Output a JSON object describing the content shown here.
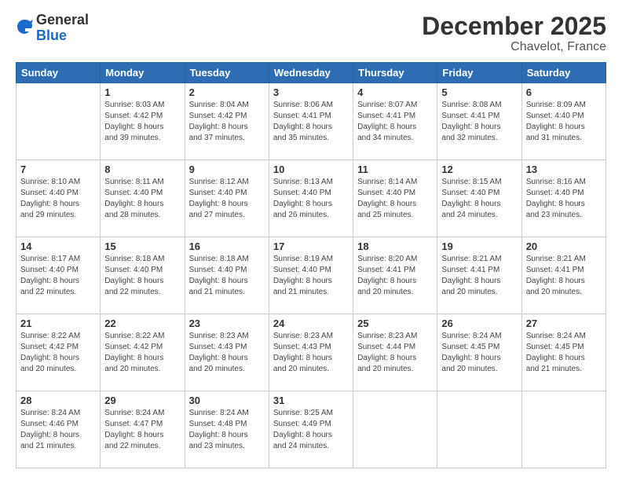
{
  "header": {
    "logo_general": "General",
    "logo_blue": "Blue",
    "month": "December 2025",
    "location": "Chavelot, France"
  },
  "days_of_week": [
    "Sunday",
    "Monday",
    "Tuesday",
    "Wednesday",
    "Thursday",
    "Friday",
    "Saturday"
  ],
  "weeks": [
    [
      {
        "day": "",
        "info": ""
      },
      {
        "day": "1",
        "info": "Sunrise: 8:03 AM\nSunset: 4:42 PM\nDaylight: 8 hours\nand 39 minutes."
      },
      {
        "day": "2",
        "info": "Sunrise: 8:04 AM\nSunset: 4:42 PM\nDaylight: 8 hours\nand 37 minutes."
      },
      {
        "day": "3",
        "info": "Sunrise: 8:06 AM\nSunset: 4:41 PM\nDaylight: 8 hours\nand 35 minutes."
      },
      {
        "day": "4",
        "info": "Sunrise: 8:07 AM\nSunset: 4:41 PM\nDaylight: 8 hours\nand 34 minutes."
      },
      {
        "day": "5",
        "info": "Sunrise: 8:08 AM\nSunset: 4:41 PM\nDaylight: 8 hours\nand 32 minutes."
      },
      {
        "day": "6",
        "info": "Sunrise: 8:09 AM\nSunset: 4:40 PM\nDaylight: 8 hours\nand 31 minutes."
      }
    ],
    [
      {
        "day": "7",
        "info": "Sunrise: 8:10 AM\nSunset: 4:40 PM\nDaylight: 8 hours\nand 29 minutes."
      },
      {
        "day": "8",
        "info": "Sunrise: 8:11 AM\nSunset: 4:40 PM\nDaylight: 8 hours\nand 28 minutes."
      },
      {
        "day": "9",
        "info": "Sunrise: 8:12 AM\nSunset: 4:40 PM\nDaylight: 8 hours\nand 27 minutes."
      },
      {
        "day": "10",
        "info": "Sunrise: 8:13 AM\nSunset: 4:40 PM\nDaylight: 8 hours\nand 26 minutes."
      },
      {
        "day": "11",
        "info": "Sunrise: 8:14 AM\nSunset: 4:40 PM\nDaylight: 8 hours\nand 25 minutes."
      },
      {
        "day": "12",
        "info": "Sunrise: 8:15 AM\nSunset: 4:40 PM\nDaylight: 8 hours\nand 24 minutes."
      },
      {
        "day": "13",
        "info": "Sunrise: 8:16 AM\nSunset: 4:40 PM\nDaylight: 8 hours\nand 23 minutes."
      }
    ],
    [
      {
        "day": "14",
        "info": "Sunrise: 8:17 AM\nSunset: 4:40 PM\nDaylight: 8 hours\nand 22 minutes."
      },
      {
        "day": "15",
        "info": "Sunrise: 8:18 AM\nSunset: 4:40 PM\nDaylight: 8 hours\nand 22 minutes."
      },
      {
        "day": "16",
        "info": "Sunrise: 8:18 AM\nSunset: 4:40 PM\nDaylight: 8 hours\nand 21 minutes."
      },
      {
        "day": "17",
        "info": "Sunrise: 8:19 AM\nSunset: 4:40 PM\nDaylight: 8 hours\nand 21 minutes."
      },
      {
        "day": "18",
        "info": "Sunrise: 8:20 AM\nSunset: 4:41 PM\nDaylight: 8 hours\nand 20 minutes."
      },
      {
        "day": "19",
        "info": "Sunrise: 8:21 AM\nSunset: 4:41 PM\nDaylight: 8 hours\nand 20 minutes."
      },
      {
        "day": "20",
        "info": "Sunrise: 8:21 AM\nSunset: 4:41 PM\nDaylight: 8 hours\nand 20 minutes."
      }
    ],
    [
      {
        "day": "21",
        "info": "Sunrise: 8:22 AM\nSunset: 4:42 PM\nDaylight: 8 hours\nand 20 minutes."
      },
      {
        "day": "22",
        "info": "Sunrise: 8:22 AM\nSunset: 4:42 PM\nDaylight: 8 hours\nand 20 minutes."
      },
      {
        "day": "23",
        "info": "Sunrise: 8:23 AM\nSunset: 4:43 PM\nDaylight: 8 hours\nand 20 minutes."
      },
      {
        "day": "24",
        "info": "Sunrise: 8:23 AM\nSunset: 4:43 PM\nDaylight: 8 hours\nand 20 minutes."
      },
      {
        "day": "25",
        "info": "Sunrise: 8:23 AM\nSunset: 4:44 PM\nDaylight: 8 hours\nand 20 minutes."
      },
      {
        "day": "26",
        "info": "Sunrise: 8:24 AM\nSunset: 4:45 PM\nDaylight: 8 hours\nand 20 minutes."
      },
      {
        "day": "27",
        "info": "Sunrise: 8:24 AM\nSunset: 4:45 PM\nDaylight: 8 hours\nand 21 minutes."
      }
    ],
    [
      {
        "day": "28",
        "info": "Sunrise: 8:24 AM\nSunset: 4:46 PM\nDaylight: 8 hours\nand 21 minutes."
      },
      {
        "day": "29",
        "info": "Sunrise: 8:24 AM\nSunset: 4:47 PM\nDaylight: 8 hours\nand 22 minutes."
      },
      {
        "day": "30",
        "info": "Sunrise: 8:24 AM\nSunset: 4:48 PM\nDaylight: 8 hours\nand 23 minutes."
      },
      {
        "day": "31",
        "info": "Sunrise: 8:25 AM\nSunset: 4:49 PM\nDaylight: 8 hours\nand 24 minutes."
      },
      {
        "day": "",
        "info": ""
      },
      {
        "day": "",
        "info": ""
      },
      {
        "day": "",
        "info": ""
      }
    ]
  ]
}
